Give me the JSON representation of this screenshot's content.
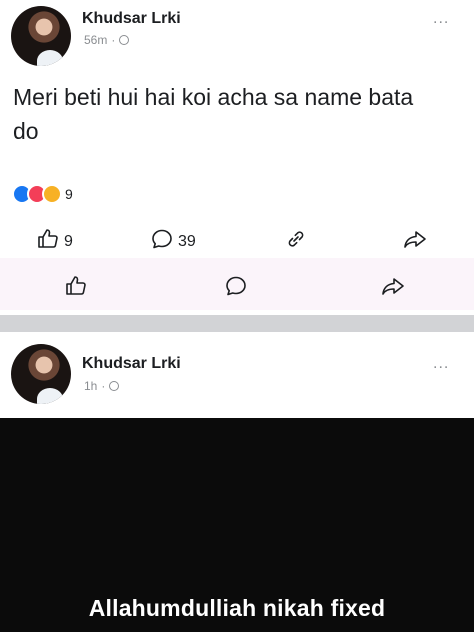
{
  "post1": {
    "author": "Khudsar Lrki",
    "time": "56m",
    "separator": "·",
    "more": "...",
    "text": "Meri beti hui hai koi acha sa name bata do",
    "reaction_count": "9",
    "like_count": "9",
    "comment_count": "39"
  },
  "post2": {
    "author": "Khudsar Lrki",
    "time": "1h",
    "separator": "·",
    "more": "...",
    "caption": "Allahumdulliah nikah fixed"
  },
  "colors": {
    "like_blue": "#1877f2",
    "love_red": "#f33e58",
    "haha_yellow": "#f7b125",
    "divider_gray": "#d2d3d6",
    "image_black": "#0b0b0b"
  },
  "icons": [
    "globe-icon",
    "more-icon",
    "like-icon",
    "comment-icon",
    "link-icon",
    "share-icon"
  ]
}
